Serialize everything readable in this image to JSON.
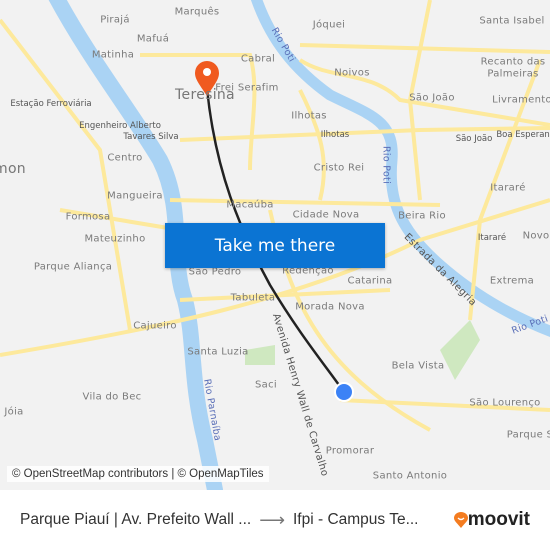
{
  "map": {
    "labels": [
      "Pirajá",
      "Marquês",
      "Jóquei",
      "Santa Isabel",
      "Mafuá",
      "Matinha",
      "Cabral",
      "Noivos",
      "Recanto das",
      "Palmeiras",
      "Teresina",
      "Frei Serafim",
      "São João",
      "Livramento",
      "Estação Ferroviária",
      "Engenheiro Alberto",
      "Tavares Silva",
      "Ilhotas",
      "Ilhotas",
      "São João",
      "Boa Esperança",
      "Centro",
      "mon",
      "Cristo Rei",
      "Itararé",
      "Mangueira",
      "Macaúba",
      "Formosa",
      "Cidade Nova",
      "Beira Rio",
      "Mateuzinho",
      "Itararé",
      "Novo",
      "Parque Aliança",
      "São Pedro",
      "Redenção",
      "Catarina",
      "Extrema",
      "Tabuleta",
      "Morada Nova",
      "Cajueiro",
      "Santa Luzia",
      "Bela Vista",
      "Saci",
      "Vila do Bec",
      "Jóia",
      "São Lourenço",
      "Parque S",
      "Promorar",
      "Santo Antonio"
    ],
    "river_labels": [
      "Rio Poti",
      "Rio Poti",
      "Rio Poti",
      "Rio Parnaíba"
    ],
    "street_labels": [
      "Estrada da Alegria",
      "Avenida Henry Wall de Carvalho"
    ],
    "colors": {
      "water": "#aad3f4",
      "road": "#fde99c",
      "route": "#222222",
      "pin": "#f05a1f",
      "origin": "#3b82f6",
      "button": "#0b74d3",
      "moovit": "#f47c20"
    }
  },
  "cta": {
    "label": "Take me there"
  },
  "attribution": "© OpenStreetMap contributors | © OpenMapTiles",
  "footer": {
    "from": "Parque Piauí | Av. Prefeito Wall ...",
    "arrow": "⟶",
    "to": "Ifpi - Campus Te...",
    "brand": "moovit"
  }
}
